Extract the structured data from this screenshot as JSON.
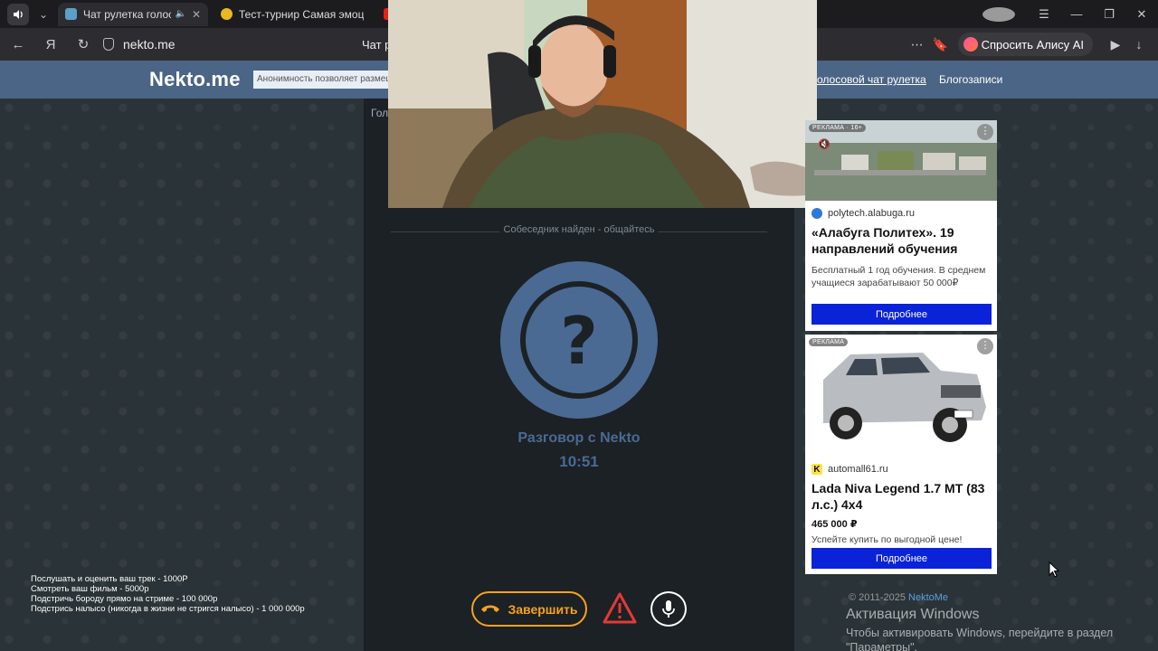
{
  "browser": {
    "tabs": [
      {
        "title": "Чат рулетка голосов",
        "active": true
      },
      {
        "title": "Тест-турнир Самая эмоц",
        "active": false
      },
      {
        "title": "",
        "active": false
      }
    ],
    "url": "nekto.me",
    "page_title": "Чат р",
    "alice_label": "Спросить Алису AI"
  },
  "site": {
    "logo": "Nekto.me",
    "slogan": "Анонимность позволяет размеща",
    "nav": [
      {
        "label": "олосовой чат рулетка"
      },
      {
        "label": "Блогозаписи"
      }
    ],
    "subheader_fragment": "Гол"
  },
  "chat": {
    "status": "Собеседник найден - общайтесь",
    "avatar_symbol": "?",
    "conversation_title": "Разговор с Nekto",
    "timer": "10:51",
    "end_label": "Завершить"
  },
  "ads": [
    {
      "badge": "РЕКЛАМА · 16+",
      "domain": "polytech.alabuga.ru",
      "headline": "«Алабуга Политех». 19 направлений обучения",
      "description": "Бесплатный 1 год обучения. В среднем учащиеся зарабатывают 50 000₽",
      "cta": "Подробнее"
    },
    {
      "badge": "РЕКЛАМА",
      "domain": "automall61.ru",
      "domain_logo": "K",
      "headline": "Lada Niva Legend 1.7 MT (83 л.с.) 4x4",
      "price": "465 000 ₽",
      "description": "Успейте купить по выгодной цене!",
      "cta": "Подробнее"
    }
  ],
  "donations": [
    "Послушать и оценить ваш трек - 1000Р",
    "Смотреть ваш фильм - 5000р",
    "Подстричь бороду прямо на стриме - 100 000р",
    "Подстрись налысо (никогда в жизни не стригся налысо) - 1 000 000р"
  ],
  "footer": {
    "copyright": "© 2011-2025",
    "brand_link": "NektoMe"
  },
  "windows_activation": {
    "title": "Активация Windows",
    "message": "Чтобы активировать Windows, перейдите в раздел \"Параметры\"."
  },
  "colors": {
    "header_blue": "#4a6585",
    "accent_orange": "#f7a31c",
    "avatar_blue": "#4a6a93",
    "ad_cta_blue": "#0a22d8"
  }
}
